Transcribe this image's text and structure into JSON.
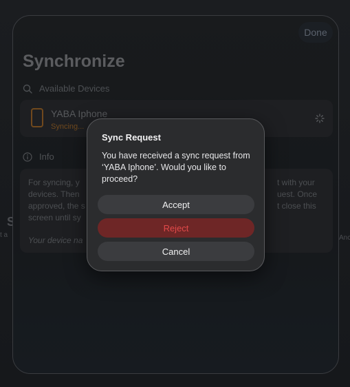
{
  "background": {
    "left_peek_big": "S",
    "left_peek_small": "t a",
    "right_peek_small": "Anc"
  },
  "sheet": {
    "done_label": "Done",
    "title": "Synchronize",
    "available_devices_header": "Available Devices",
    "device": {
      "name": "YABA Iphone",
      "status": "Syncing..."
    },
    "info_header": "Info",
    "info_lines": [
      "For syncing, y",
      "devices. Then",
      "approved, the s",
      "screen until sy"
    ],
    "info_lines_right": [
      "t with your",
      "uest. Once",
      "t close this"
    ],
    "info_footer": "Your device na"
  },
  "dialog": {
    "title": "Sync Request",
    "body": "You have received a sync request from ‘YABA Iphone’.  Would you like to proceed?",
    "accept_label": "Accept",
    "reject_label": "Reject",
    "cancel_label": "Cancel"
  },
  "colors": {
    "accent_orange": "#8a5a24",
    "destructive_red": "#e24a4a",
    "dialog_bg": "#2b2c2e"
  },
  "icons": {
    "search": "search-icon",
    "info": "info-icon",
    "phone": "phone-icon",
    "spinner": "spinner-icon"
  }
}
